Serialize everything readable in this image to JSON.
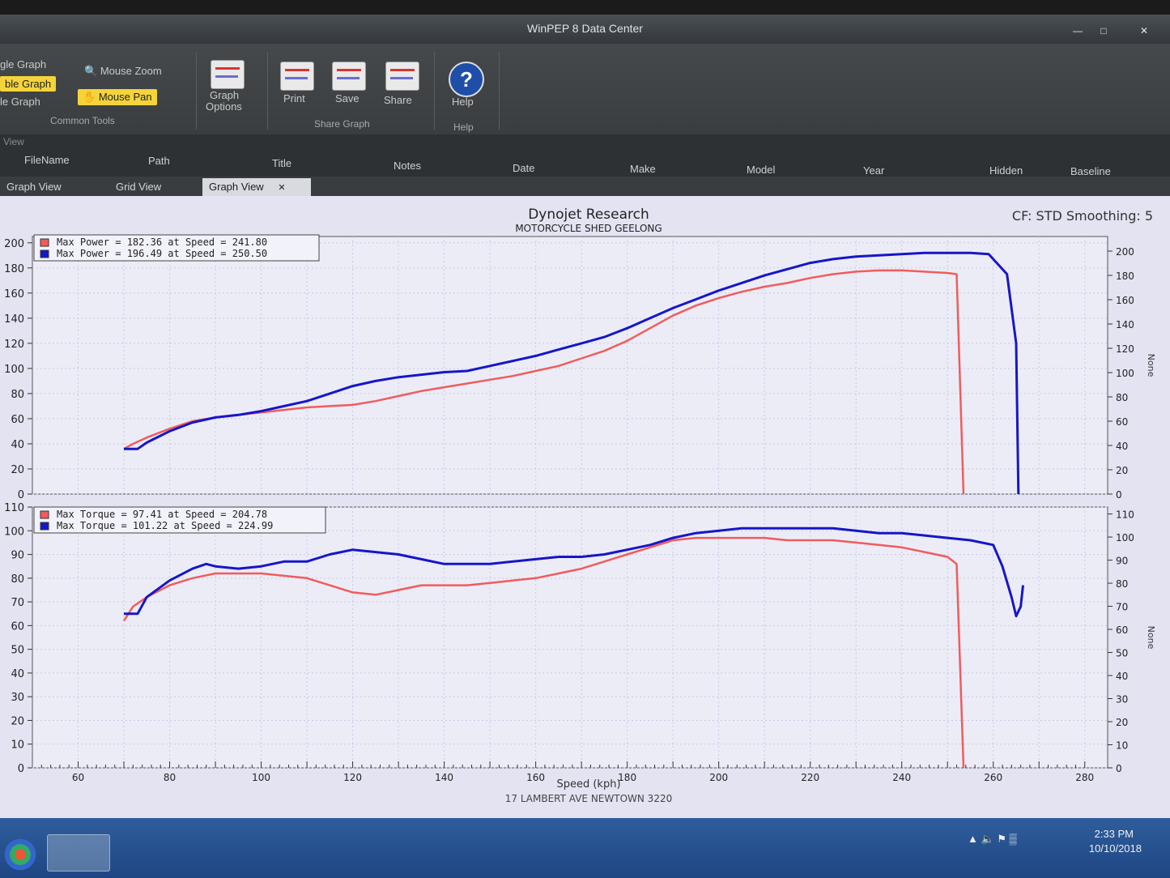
{
  "window": {
    "title": "WinPEP 8 Data Center",
    "controls": [
      "—",
      "□",
      "✕"
    ]
  },
  "ribbon": {
    "graph_modes": [
      "gle Graph",
      "ble Graph",
      "le Graph"
    ],
    "mouse_zoom": "Mouse Zoom",
    "mouse_pan": "Mouse Pan",
    "common_tools": "Common Tools",
    "graph_options_1": "Graph",
    "graph_options_2": "Options",
    "print": "Print",
    "save": "Save",
    "share": "Share",
    "share_graph": "Share Graph",
    "help": "Help",
    "help_group": "Help"
  },
  "file_panel": {
    "label": "View",
    "columns": [
      "FileName",
      "Path",
      "Title",
      "Notes",
      "Date",
      "Make",
      "Model",
      "Year",
      "Hidden",
      "Baseline"
    ]
  },
  "tabs": [
    "Graph View",
    "Grid View",
    "Graph View"
  ],
  "tab_close": "✕",
  "header": {
    "title": "Dynojet Research",
    "subtitle": "MOTORCYCLE SHED GEELONG",
    "cf_text": "CF: STD Smoothing: 5",
    "footer": "17 LAMBERT AVE NEWTOWN 3220"
  },
  "colors": {
    "red": "#f05c5c",
    "blue": "#1616c8"
  },
  "chart_data": [
    {
      "type": "line",
      "title": "Power",
      "xlabel": "Speed (kph)",
      "ylabel": "",
      "ylabel_right": "None",
      "xlim": [
        50,
        285
      ],
      "ylim": [
        0,
        205
      ],
      "ylim_right": [
        0,
        212
      ],
      "y_ticks": [
        0,
        20,
        40,
        60,
        80,
        100,
        120,
        140,
        160,
        180,
        200
      ],
      "y_ticks_right": [
        0,
        20,
        40,
        60,
        80,
        100,
        120,
        140,
        160,
        180,
        200
      ],
      "grid": true,
      "legend_position": "top-left",
      "legend": [
        "Max Power = 182.36 at Speed = 241.80",
        "Max Power = 196.49 at Speed = 250.50"
      ],
      "series": [
        {
          "color": "#f05c5c",
          "points": [
            [
              70,
              36
            ],
            [
              72,
              40
            ],
            [
              75,
              45
            ],
            [
              80,
              52
            ],
            [
              85,
              58
            ],
            [
              90,
              61
            ],
            [
              95,
              63
            ],
            [
              100,
              65
            ],
            [
              105,
              67
            ],
            [
              110,
              69
            ],
            [
              115,
              70
            ],
            [
              120,
              71
            ],
            [
              125,
              74
            ],
            [
              130,
              78
            ],
            [
              135,
              82
            ],
            [
              140,
              85
            ],
            [
              145,
              88
            ],
            [
              150,
              91
            ],
            [
              155,
              94
            ],
            [
              160,
              98
            ],
            [
              165,
              102
            ],
            [
              170,
              108
            ],
            [
              175,
              114
            ],
            [
              180,
              122
            ],
            [
              185,
              132
            ],
            [
              190,
              142
            ],
            [
              195,
              150
            ],
            [
              200,
              156
            ],
            [
              205,
              161
            ],
            [
              210,
              165
            ],
            [
              215,
              168
            ],
            [
              220,
              172
            ],
            [
              225,
              175
            ],
            [
              230,
              177
            ],
            [
              235,
              178
            ],
            [
              240,
              178
            ],
            [
              245,
              177
            ],
            [
              250,
              176
            ],
            [
              252,
              175
            ],
            [
              253.5,
              0
            ]
          ]
        },
        {
          "color": "#1616c8",
          "points": [
            [
              70,
              36
            ],
            [
              73,
              36
            ],
            [
              75,
              41
            ],
            [
              80,
              50
            ],
            [
              85,
              57
            ],
            [
              90,
              61
            ],
            [
              95,
              63
            ],
            [
              100,
              66
            ],
            [
              105,
              70
            ],
            [
              110,
              74
            ],
            [
              115,
              80
            ],
            [
              120,
              86
            ],
            [
              125,
              90
            ],
            [
              130,
              93
            ],
            [
              135,
              95
            ],
            [
              140,
              97
            ],
            [
              145,
              98
            ],
            [
              150,
              102
            ],
            [
              155,
              106
            ],
            [
              160,
              110
            ],
            [
              165,
              115
            ],
            [
              170,
              120
            ],
            [
              175,
              125
            ],
            [
              180,
              132
            ],
            [
              185,
              140
            ],
            [
              190,
              148
            ],
            [
              195,
              155
            ],
            [
              200,
              162
            ],
            [
              205,
              168
            ],
            [
              210,
              174
            ],
            [
              215,
              179
            ],
            [
              220,
              184
            ],
            [
              225,
              187
            ],
            [
              230,
              189
            ],
            [
              235,
              190
            ],
            [
              240,
              191
            ],
            [
              245,
              192
            ],
            [
              250,
              192
            ],
            [
              255,
              192
            ],
            [
              259,
              191
            ],
            [
              263,
              175
            ],
            [
              265,
              120
            ],
            [
              265.5,
              0
            ]
          ]
        }
      ]
    },
    {
      "type": "line",
      "title": "Torque",
      "xlabel": "Speed (kph)",
      "ylabel": "",
      "ylabel_right": "None",
      "xlim": [
        50,
        285
      ],
      "ylim": [
        0,
        110
      ],
      "ylim_right": [
        0,
        113
      ],
      "y_ticks": [
        0,
        10,
        20,
        30,
        40,
        50,
        60,
        70,
        80,
        90,
        100,
        110
      ],
      "y_ticks_right": [
        0,
        10,
        20,
        30,
        40,
        50,
        60,
        70,
        80,
        90,
        100,
        110
      ],
      "x_ticks": [
        60,
        80,
        100,
        120,
        140,
        160,
        180,
        200,
        220,
        240,
        260,
        280
      ],
      "grid": true,
      "legend_position": "top-left",
      "legend": [
        "Max Torque = 97.41 at Speed = 204.78",
        "Max Torque = 101.22 at Speed = 224.99"
      ],
      "series": [
        {
          "color": "#f05c5c",
          "points": [
            [
              70,
              62
            ],
            [
              72,
              68
            ],
            [
              75,
              72
            ],
            [
              80,
              77
            ],
            [
              85,
              80
            ],
            [
              90,
              82
            ],
            [
              95,
              82
            ],
            [
              100,
              82
            ],
            [
              105,
              81
            ],
            [
              110,
              80
            ],
            [
              115,
              77
            ],
            [
              120,
              74
            ],
            [
              125,
              73
            ],
            [
              130,
              75
            ],
            [
              135,
              77
            ],
            [
              140,
              77
            ],
            [
              145,
              77
            ],
            [
              150,
              78
            ],
            [
              155,
              79
            ],
            [
              160,
              80
            ],
            [
              165,
              82
            ],
            [
              170,
              84
            ],
            [
              175,
              87
            ],
            [
              180,
              90
            ],
            [
              185,
              93
            ],
            [
              190,
              96
            ],
            [
              195,
              97
            ],
            [
              200,
              97
            ],
            [
              205,
              97
            ],
            [
              210,
              97
            ],
            [
              215,
              96
            ],
            [
              220,
              96
            ],
            [
              225,
              96
            ],
            [
              230,
              95
            ],
            [
              235,
              94
            ],
            [
              240,
              93
            ],
            [
              245,
              91
            ],
            [
              250,
              89
            ],
            [
              252,
              86
            ],
            [
              253.5,
              0
            ]
          ]
        },
        {
          "color": "#1616c8",
          "points": [
            [
              70,
              65
            ],
            [
              73,
              65
            ],
            [
              75,
              72
            ],
            [
              80,
              79
            ],
            [
              85,
              84
            ],
            [
              88,
              86
            ],
            [
              90,
              85
            ],
            [
              95,
              84
            ],
            [
              100,
              85
            ],
            [
              105,
              87
            ],
            [
              110,
              87
            ],
            [
              115,
              90
            ],
            [
              120,
              92
            ],
            [
              125,
              91
            ],
            [
              130,
              90
            ],
            [
              135,
              88
            ],
            [
              140,
              86
            ],
            [
              145,
              86
            ],
            [
              150,
              86
            ],
            [
              155,
              87
            ],
            [
              160,
              88
            ],
            [
              165,
              89
            ],
            [
              170,
              89
            ],
            [
              175,
              90
            ],
            [
              180,
              92
            ],
            [
              185,
              94
            ],
            [
              190,
              97
            ],
            [
              195,
              99
            ],
            [
              200,
              100
            ],
            [
              205,
              101
            ],
            [
              210,
              101
            ],
            [
              215,
              101
            ],
            [
              220,
              101
            ],
            [
              225,
              101
            ],
            [
              230,
              100
            ],
            [
              235,
              99
            ],
            [
              240,
              99
            ],
            [
              245,
              98
            ],
            [
              250,
              97
            ],
            [
              255,
              96
            ],
            [
              260,
              94
            ],
            [
              262,
              85
            ],
            [
              264,
              72
            ],
            [
              265,
              64
            ],
            [
              266,
              68
            ],
            [
              266.5,
              77
            ]
          ]
        }
      ]
    }
  ],
  "taskbar": {
    "time": "2:33 PM",
    "date": "10/10/2018"
  }
}
